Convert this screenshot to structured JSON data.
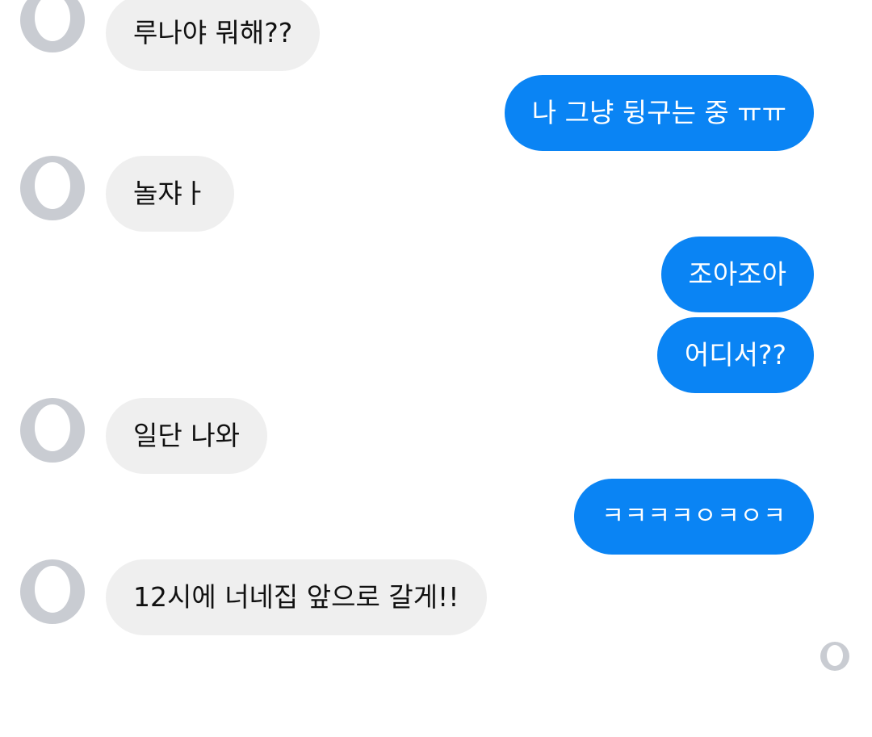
{
  "conversation": {
    "m1": "루나야 뭐해??",
    "m2": "나 그냥 뒹구는 중 ㅠㅠ",
    "m3": "놀쟈ㅏ",
    "m4": "조아조아",
    "m5": "어디서??",
    "m6": "일단 나와",
    "m7": "ㅋㅋㅋㅋㅇㅋㅇㅋ",
    "m8": "12시에 너네집 앞으로 갈게!!"
  },
  "icons": {
    "avatar": "user-avatar-icon",
    "read_receipt": "seen-avatar-icon"
  },
  "colors": {
    "incoming_bubble": "#efefef",
    "outgoing_bubble": "#0a84f4",
    "avatar": "#c9ccd2"
  }
}
